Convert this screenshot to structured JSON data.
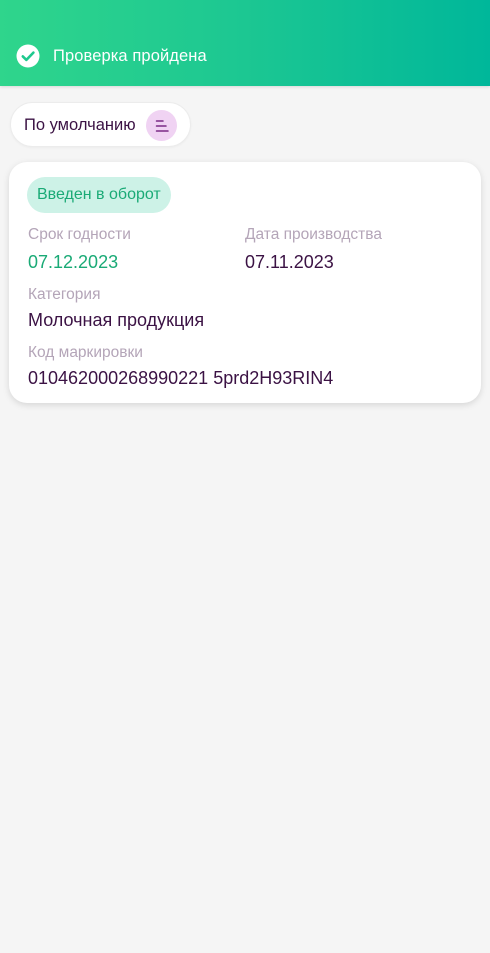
{
  "header": {
    "status_text": "Проверка пройдена",
    "status_icon": "check-circle-icon",
    "gradient_start": "#2fd58c",
    "gradient_end": "#00b79a"
  },
  "sort": {
    "label": "По умолчанию",
    "icon": "sort-lines-icon"
  },
  "card": {
    "badge": "Введен в оборот",
    "expiry_label": "Срок годности",
    "expiry_value": "07.12.2023",
    "production_label": "Дата производства",
    "production_value": "07.11.2023",
    "category_label": "Категория",
    "category_value": "Молочная продукция",
    "code_label": "Код маркировки",
    "code_value": "010462000268990221 5prd2H93RIN4"
  },
  "colors": {
    "accent_green": "#1aaa76",
    "text_dark": "#3b1244",
    "label_muted": "#b4a5b8",
    "background": "#f5f5f5"
  }
}
